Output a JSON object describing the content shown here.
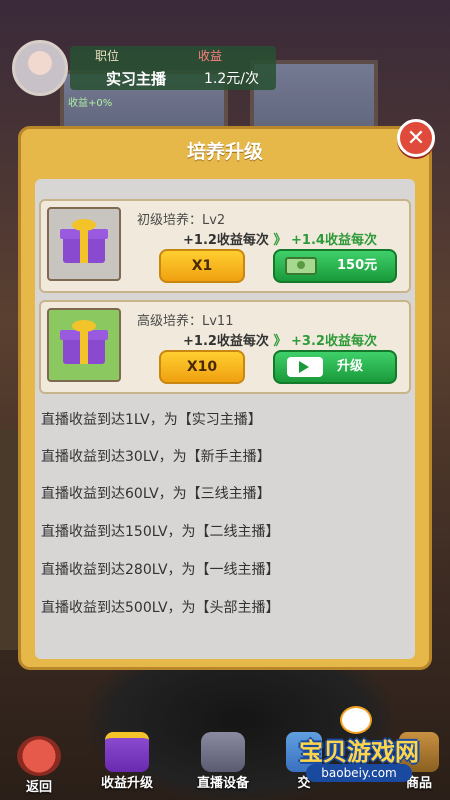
{
  "header": {
    "job_label": "职位",
    "job_value": "实习主播",
    "income_label": "收益",
    "income_value": "1.2元/次",
    "bonus": "收益+0%"
  },
  "modal": {
    "title": "培养升级",
    "close_icon": "close-icon",
    "cards": [
      {
        "title": "初级培养：Lv2",
        "current": "+1.2收益每次",
        "arrow": "》",
        "next": "+1.4收益每次",
        "multiplier": "X1",
        "action_icon": "cash-icon",
        "action_label": "150元"
      },
      {
        "title": "高级培养：Lv11",
        "current": "+1.2收益每次",
        "arrow": "》",
        "next": "+3.2收益每次",
        "multiplier": "X10",
        "action_icon": "video-icon",
        "action_label": "升级"
      }
    ],
    "levels": [
      "直播收益到达1LV，为【实习主播】",
      "直播收益到达30LV，为【新手主播】",
      "直播收益到达60LV，为【三线主播】",
      "直播收益到达150LV，为【二线主播】",
      "直播收益到达280LV，为【一线主播】",
      "直播收益到达500LV，为【头部主播】"
    ]
  },
  "bottom_nav": [
    {
      "label": "返回",
      "icon": "back-icon"
    },
    {
      "label": "收益升级",
      "icon": "gift-icon"
    },
    {
      "label": "直播设备",
      "icon": "camera-icon"
    },
    {
      "label": "交",
      "icon": "phone-icon"
    },
    {
      "label": "商品",
      "icon": "box-icon"
    }
  ],
  "watermark": {
    "text": "宝贝游戏网",
    "url": "baobeiy.com"
  },
  "colors": {
    "modal_bg": "#e6b84a",
    "btn_yellow": "#f0a010",
    "btn_green": "#1a9a3a",
    "accent_green": "#2f9a3a",
    "close_red": "#e04a3a"
  }
}
